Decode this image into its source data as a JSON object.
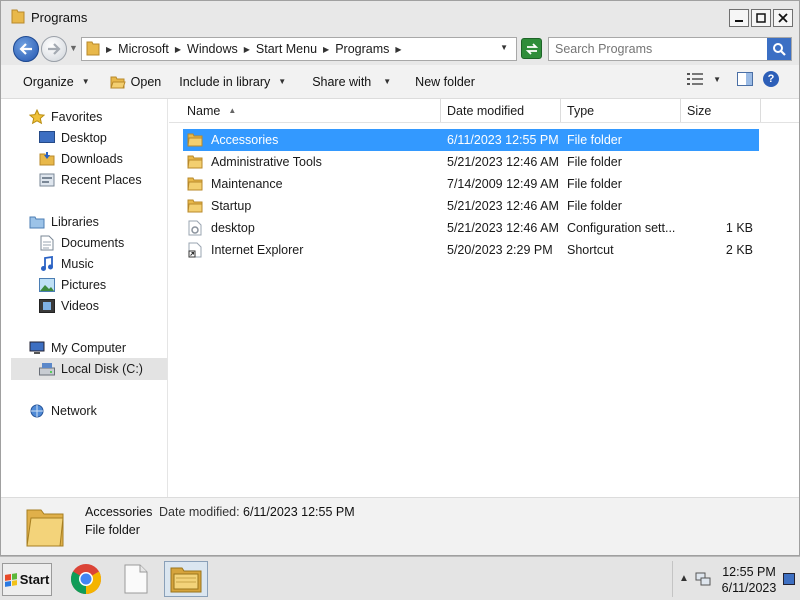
{
  "window": {
    "title": "Programs"
  },
  "address": {
    "crumbs": [
      "Microsoft",
      "Windows",
      "Start Menu",
      "Programs"
    ]
  },
  "search": {
    "placeholder": "Search Programs"
  },
  "toolbar": {
    "organize": "Organize",
    "open": "Open",
    "include_in_library": "Include in library",
    "share_with": "Share with",
    "new_folder": "New folder"
  },
  "navpane": {
    "favorites": "Favorites",
    "favorites_items": [
      "Desktop",
      "Downloads",
      "Recent Places"
    ],
    "libraries": "Libraries",
    "libraries_items": [
      "Documents",
      "Music",
      "Pictures",
      "Videos"
    ],
    "my_computer": "My Computer",
    "local_disk": "Local Disk (C:)",
    "network": "Network"
  },
  "columns": {
    "name": "Name",
    "date_modified": "Date modified",
    "type": "Type",
    "size": "Size"
  },
  "files": [
    {
      "name": "Accessories",
      "date": "6/11/2023 12:55 PM",
      "type": "File folder",
      "size": "",
      "icon": "folder-icon",
      "selected": true
    },
    {
      "name": "Administrative Tools",
      "date": "5/21/2023 12:46 AM",
      "type": "File folder",
      "size": "",
      "icon": "folder-icon",
      "selected": false
    },
    {
      "name": "Maintenance",
      "date": "7/14/2009 12:49 AM",
      "type": "File folder",
      "size": "",
      "icon": "folder-icon",
      "selected": false
    },
    {
      "name": "Startup",
      "date": "5/21/2023 12:46 AM",
      "type": "File folder",
      "size": "",
      "icon": "folder-icon",
      "selected": false
    },
    {
      "name": "desktop",
      "date": "5/21/2023 12:46 AM",
      "type": "Configuration sett...",
      "size": "1 KB",
      "icon": "config-file-icon",
      "selected": false
    },
    {
      "name": "Internet Explorer",
      "date": "5/20/2023 2:29 PM",
      "type": "Shortcut",
      "size": "2 KB",
      "icon": "shortcut-icon",
      "selected": false
    }
  ],
  "details": {
    "name": "Accessories",
    "modified_label": "Date modified:",
    "modified_value": "6/11/2023 12:55 PM",
    "type": "File folder"
  },
  "taskbar": {
    "start_label": "Start",
    "time": "12:55 PM",
    "date": "6/11/2023"
  },
  "colors": {
    "selection": "#3399ff",
    "folder": "#e8b84a"
  }
}
